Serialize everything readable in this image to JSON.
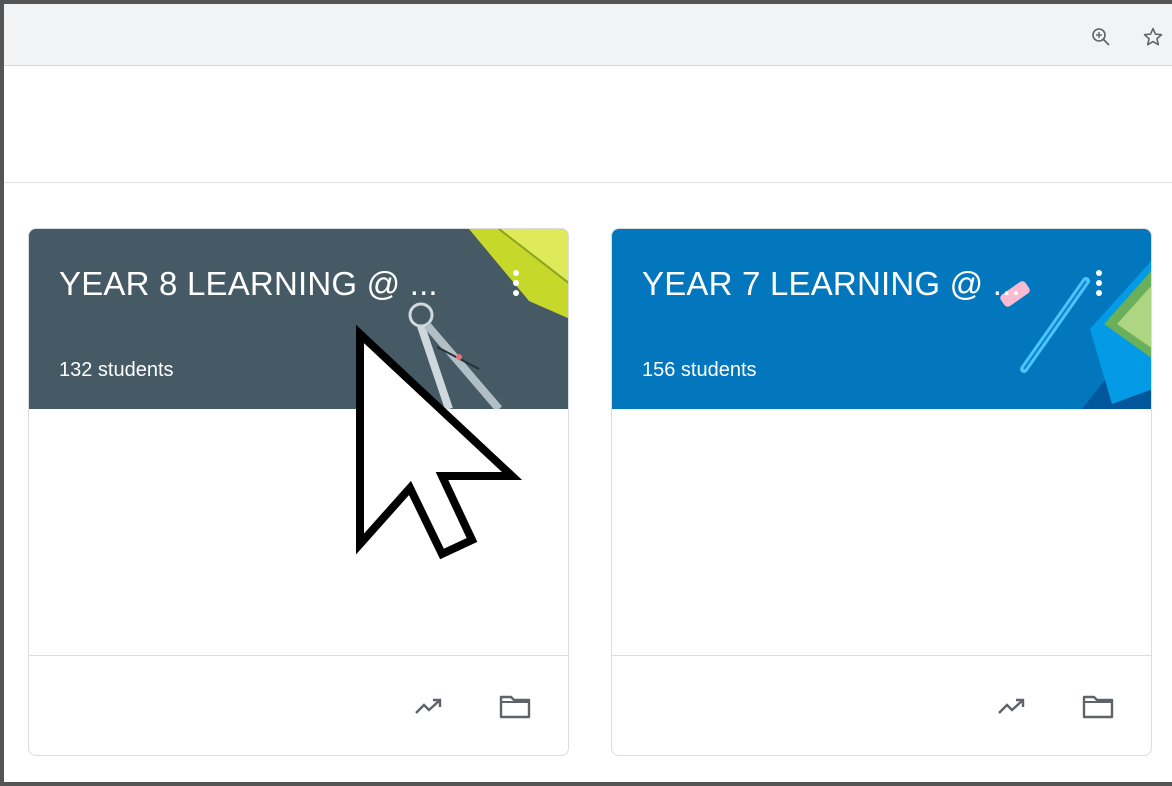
{
  "toolbar": {
    "zoom_icon": "zoom-in-icon",
    "bookmark_icon": "star-icon"
  },
  "classes": [
    {
      "title": "YEAR 8 LEARNING @ ...",
      "students": "132 students",
      "header_color": "#455a64",
      "theme": "geometry-compass"
    },
    {
      "title": "YEAR 7 LEARNING @ ...",
      "students": "156 students",
      "header_color": "#0277bd",
      "theme": "pens-notebook"
    }
  ],
  "card_actions": {
    "progress_icon": "trending-up-icon",
    "folder_icon": "folder-icon",
    "menu_icon": "more-vert-icon"
  },
  "colors": {
    "icon_gray": "#5f6368",
    "divider": "#dadce0"
  }
}
